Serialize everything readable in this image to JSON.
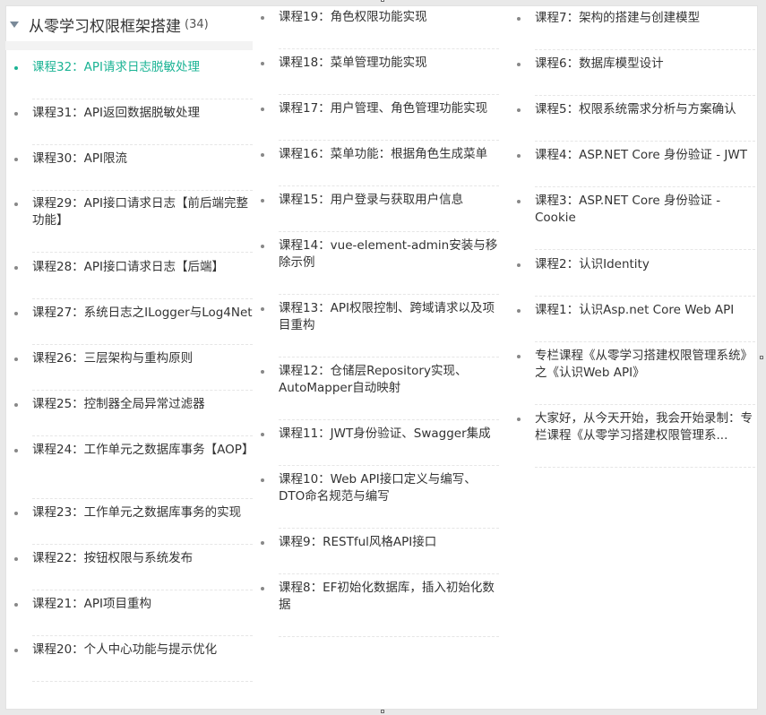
{
  "series_title": "从零学习权限框架搭建",
  "series_count": "(34)",
  "columns": [
    {
      "items": [
        {
          "label": "课程32：API请求日志脱敏处理",
          "active": true
        },
        {
          "label": "课程31：API返回数据脱敏处理"
        },
        {
          "label": "课程30：API限流"
        },
        {
          "label": "课程29：API接口请求日志【前后端完整功能】"
        },
        {
          "label": "课程28：API接口请求日志【后端】"
        },
        {
          "label": "课程27：系统日志之ILogger与Log4Net"
        },
        {
          "label": "课程26：三层架构与重构原则"
        },
        {
          "label": "课程25：控制器全局异常过滤器"
        },
        {
          "label": "课程24：工作单元之数据库事务【AOP】"
        },
        {
          "label": "课程23：工作单元之数据库事务的实现"
        },
        {
          "label": "课程22：按钮权限与系统发布"
        },
        {
          "label": "课程21：API项目重构"
        },
        {
          "label": "课程20：个人中心功能与提示优化"
        }
      ]
    },
    {
      "items": [
        {
          "label": "课程19：角色权限功能实现"
        },
        {
          "label": "课程18：菜单管理功能实现"
        },
        {
          "label": "课程17：用户管理、角色管理功能实现"
        },
        {
          "label": "课程16：菜单功能：根据角色生成菜单"
        },
        {
          "label": "课程15：用户登录与获取用户信息"
        },
        {
          "label": "课程14：vue-element-admin安装与移除示例"
        },
        {
          "label": "课程13：API权限控制、跨域请求以及项目重构"
        },
        {
          "label": "课程12：仓储层Repository实现、AutoMapper自动映射"
        },
        {
          "label": "课程11：JWT身份验证、Swagger集成"
        },
        {
          "label": "课程10：Web API接口定义与编写、DTO命名规范与编写"
        },
        {
          "label": "课程9：RESTful风格API接口"
        },
        {
          "label": "课程8：EF初始化数据库，插入初始化数据"
        }
      ]
    },
    {
      "items": [
        {
          "label": "课程7：架构的搭建与创建模型"
        },
        {
          "label": "课程6：数据库模型设计"
        },
        {
          "label": "课程5：权限系统需求分析与方案确认"
        },
        {
          "label": "课程4：ASP.NET Core 身份验证 - JWT"
        },
        {
          "label": "课程3：ASP.NET Core 身份验证 - Cookie"
        },
        {
          "label": "课程2：认识Identity"
        },
        {
          "label": "课程1：认识Asp.net Core Web API"
        },
        {
          "label": "专栏课程《从零学习搭建权限管理系统》之《认识Web API》"
        },
        {
          "label": "大家好，从今天开始，我会开始录制：专栏课程《从零学习搭建权限管理系..."
        }
      ]
    }
  ]
}
